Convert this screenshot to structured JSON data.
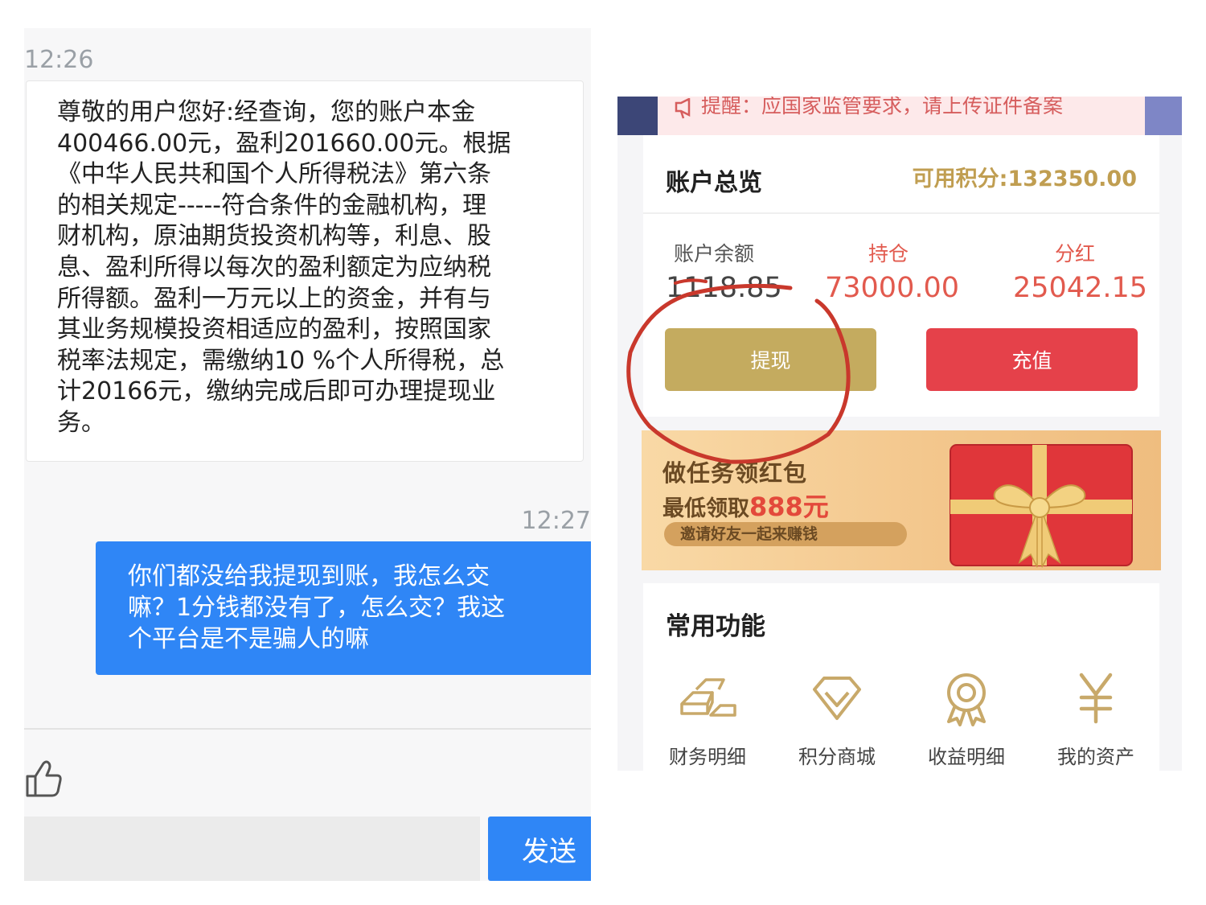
{
  "chat": {
    "timestamp_1": "12:26",
    "incoming_message": "尊敬的用户您好:经查询，您的账户本金\n400466.00元，盈利201660.00元。根据\n《中华人民共和国个人所得税法》第六条\n的相关规定-----符合条件的金融机构，理\n财机构，原油期货投资机构等，利息、股\n息、盈利所得以每次的盈利额定为应纳税\n所得额。盈利一万元以上的资金，并有与\n其业务规模投资相适应的盈利，按照国家\n税率法规定，需缴纳10 %个人所得税，总\n计20166元，缴纳完成后即可办理提现业\n务。",
    "timestamp_2": "12:27",
    "outgoing_message": "你们都没给我提现到账，我怎么交\n嘛？1分钱都没有了，怎么交？我这\n个平台是不是骗人的嘛",
    "input_value": "",
    "send_label": "发送",
    "like_icon": "thumbs-up-icon"
  },
  "app": {
    "notice_text": "提醒：应国家监管要求，请上传证件备案",
    "overview": {
      "title": "账户总览",
      "points": "可用积分:132350.00",
      "stats": [
        {
          "label": "账户余额",
          "value": "1118.85"
        },
        {
          "label": "持仓",
          "value": "73000.00"
        },
        {
          "label": "分红",
          "value": "25042.15"
        }
      ],
      "withdraw_label": "提现",
      "recharge_label": "充值"
    },
    "banner": {
      "title": "做任务领红包",
      "sub_prefix": "最低领取",
      "sub_amount": "888元",
      "pill": "邀请好友一起来赚钱"
    },
    "functions": {
      "title": "常用功能",
      "items": [
        {
          "label": "财务明细",
          "icon": "gold-bars-icon"
        },
        {
          "label": "积分商城",
          "icon": "diamond-icon"
        },
        {
          "label": "收益明细",
          "icon": "award-medal-icon"
        },
        {
          "label": "我的资产",
          "icon": "yen-icon"
        }
      ]
    },
    "colors": {
      "gold": "#c4ab5f",
      "red": "#e5414a",
      "icon_gold": "#c8a96a",
      "annotation_circle": "#c9382c"
    }
  }
}
